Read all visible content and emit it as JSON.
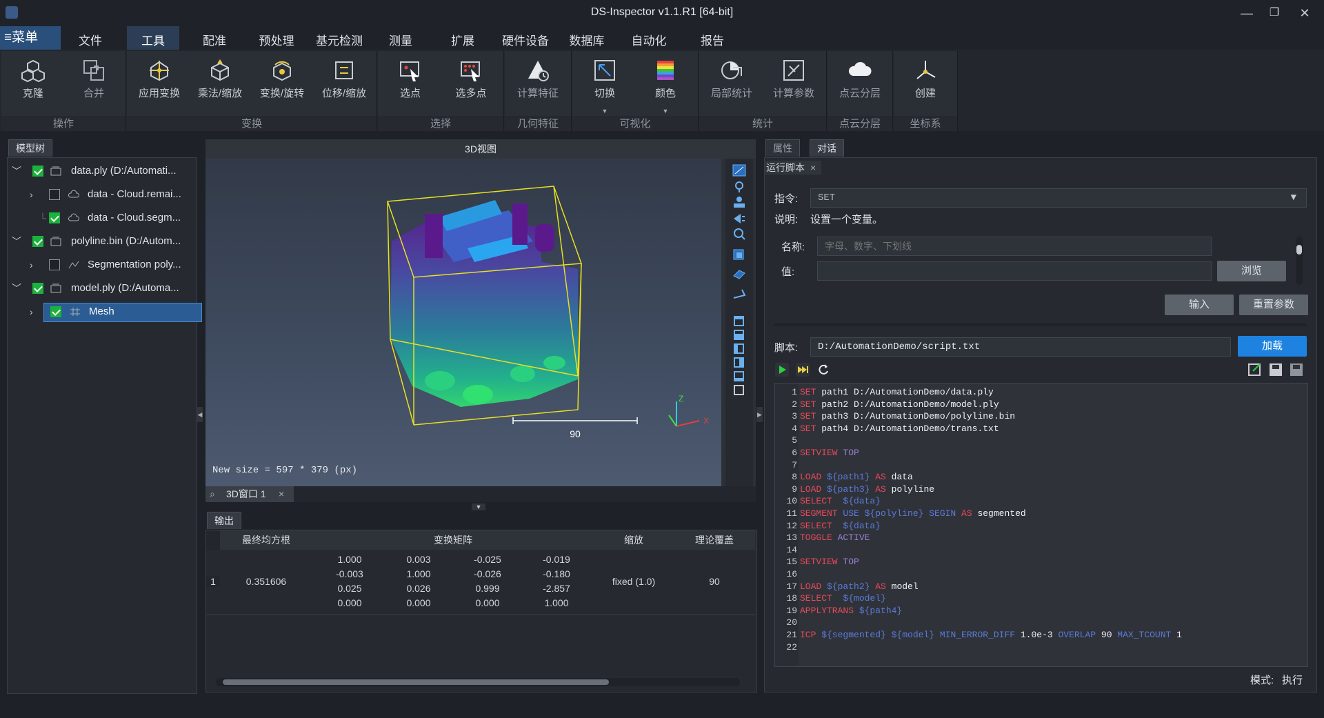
{
  "window": {
    "title": "DS-Inspector v1.1.R1 [64-bit]",
    "min": "—",
    "restore": "❐",
    "close": "✕"
  },
  "menu": {
    "main_label": "≡菜单",
    "tabs": [
      "文件",
      "工具",
      "配准",
      "预处理",
      "基元检测",
      "测量",
      "扩展",
      "硬件设备",
      "数据库",
      "自动化",
      "报告"
    ],
    "active_tab": "工具"
  },
  "ribbon": {
    "groups": [
      {
        "label": "操作",
        "buttons": [
          "克隆",
          "合并"
        ]
      },
      {
        "label": "变换",
        "buttons": [
          "应用变换",
          "乘法/缩放",
          "变换/旋转",
          "位移/缩放"
        ]
      },
      {
        "label": "选择",
        "buttons": [
          "选点",
          "选多点"
        ]
      },
      {
        "label": "几何特征",
        "buttons": [
          "计算特征"
        ]
      },
      {
        "label": "可视化",
        "buttons": [
          "切换",
          "颜色"
        ]
      },
      {
        "label": "统计",
        "buttons": [
          "局部统计",
          "计算参数"
        ]
      },
      {
        "label": "点云分层",
        "buttons": [
          "点云分层"
        ]
      },
      {
        "label": "坐标系",
        "buttons": [
          "创建"
        ]
      }
    ]
  },
  "model_tree": {
    "tab": "模型树",
    "items": [
      {
        "label": "data.ply (D:/Automati...",
        "checked": true,
        "expanded": true,
        "level": 0
      },
      {
        "label": "data - Cloud.remai...",
        "checked": false,
        "expanded": false,
        "level": 1
      },
      {
        "label": "data - Cloud.segm...",
        "checked": true,
        "expanded": null,
        "level": 1
      },
      {
        "label": "polyline.bin (D:/Autom...",
        "checked": true,
        "expanded": true,
        "level": 0
      },
      {
        "label": "Segmentation poly...",
        "checked": false,
        "expanded": false,
        "level": 1
      },
      {
        "label": "model.ply (D:/Automa...",
        "checked": true,
        "expanded": true,
        "level": 0
      },
      {
        "label": "Mesh",
        "checked": true,
        "expanded": false,
        "level": 1,
        "selected": true
      }
    ]
  },
  "view3d": {
    "title": "3D视图",
    "status": "New size = 597 * 379 (px)",
    "scale_label": "90",
    "axis_z": "Z",
    "axis_x": "X",
    "tab_label": "3D窗口 1",
    "tab_close": "×"
  },
  "output": {
    "tab": "输出",
    "columns": [
      "最终均方根",
      "变换矩阵",
      "缩放",
      "理论覆盖"
    ],
    "rows": [
      {
        "index": "1",
        "rms": "0.351606",
        "matrix": [
          [
            "1.000",
            "0.003",
            "-0.025",
            "-0.019"
          ],
          [
            "-0.003",
            "1.000",
            "-0.026",
            "-0.180"
          ],
          [
            "0.025",
            "0.026",
            "0.999",
            "-2.857"
          ],
          [
            "0.000",
            "0.000",
            "0.000",
            "1.000"
          ]
        ],
        "scale": "fixed (1.0)",
        "overlap": "90"
      }
    ]
  },
  "right_panel": {
    "tabs": [
      "属性",
      "对话"
    ],
    "active_tab": "对话",
    "sub_tab": "运行脚本",
    "sub_tab_close": "×",
    "command_label": "指令:",
    "command_value": "SET",
    "desc_label": "说明:",
    "desc_value": "设置一个变量。",
    "name_label": "名称:",
    "name_placeholder": "字母、数字、下划线",
    "value_label": "值:",
    "value_value": "",
    "browse_button": "浏览",
    "input_button": "输入",
    "reset_button": "重置参数",
    "script_label": "脚本:",
    "script_path": "D:/AutomationDemo/script.txt",
    "load_button": "加载",
    "mode_label": "模式:",
    "mode_value": "执行"
  },
  "script_lines": [
    [
      "1",
      [
        [
          "kw",
          "SET"
        ],
        [
          "tx",
          " path1 D:/AutomationDemo/data.ply"
        ]
      ]
    ],
    [
      "2",
      [
        [
          "kw",
          "SET"
        ],
        [
          "tx",
          " path2 D:/AutomationDemo/model.ply"
        ]
      ]
    ],
    [
      "3",
      [
        [
          "kw",
          "SET"
        ],
        [
          "tx",
          " path3 D:/AutomationDemo/polyline.bin"
        ]
      ]
    ],
    [
      "4",
      [
        [
          "kw",
          "SET"
        ],
        [
          "tx",
          " path4 D:/AutomationDemo/trans.txt"
        ]
      ]
    ],
    [
      "5",
      []
    ],
    [
      "6",
      [
        [
          "kw",
          "SETVIEW"
        ],
        [
          "dk",
          " TOP"
        ]
      ]
    ],
    [
      "7",
      []
    ],
    [
      "8",
      [
        [
          "kw",
          "LOAD"
        ],
        [
          "vr",
          " ${path1} "
        ],
        [
          "kw",
          "AS"
        ],
        [
          "tx",
          " data"
        ]
      ]
    ],
    [
      "9",
      [
        [
          "kw",
          "LOAD"
        ],
        [
          "vr",
          " ${path3} "
        ],
        [
          "kw",
          "AS"
        ],
        [
          "tx",
          " polyline"
        ]
      ]
    ],
    [
      "10",
      [
        [
          "kw",
          "SELECT"
        ],
        [
          "vr",
          "  ${data}"
        ]
      ]
    ],
    [
      "11",
      [
        [
          "kw",
          "SEGMENT"
        ],
        [
          "vr",
          " USE ${polyline} SEGIN "
        ],
        [
          "kw",
          "AS"
        ],
        [
          "tx",
          " segmented"
        ]
      ]
    ],
    [
      "12",
      [
        [
          "kw",
          "SELECT"
        ],
        [
          "vr",
          "  ${data}"
        ]
      ]
    ],
    [
      "13",
      [
        [
          "kw",
          "TOGGLE"
        ],
        [
          "dk",
          " ACTIVE"
        ]
      ]
    ],
    [
      "14",
      []
    ],
    [
      "15",
      [
        [
          "kw",
          "SETVIEW"
        ],
        [
          "dk",
          " TOP"
        ]
      ]
    ],
    [
      "16",
      []
    ],
    [
      "17",
      [
        [
          "kw",
          "LOAD"
        ],
        [
          "vr",
          " ${path2} "
        ],
        [
          "kw",
          "AS"
        ],
        [
          "tx",
          " model"
        ]
      ]
    ],
    [
      "18",
      [
        [
          "kw",
          "SELECT"
        ],
        [
          "vr",
          "  ${model}"
        ]
      ]
    ],
    [
      "19",
      [
        [
          "kw",
          "APPLYTRANS"
        ],
        [
          "vr",
          " ${path4}"
        ]
      ]
    ],
    [
      "20",
      []
    ],
    [
      "21",
      [
        [
          "kw",
          "ICP"
        ],
        [
          "vr",
          " ${segmented} ${model} MIN_ERROR_DIFF "
        ],
        [
          "tx",
          "1.0e-3 "
        ],
        [
          "vr",
          "OVERLAP "
        ],
        [
          "tx",
          "90 "
        ],
        [
          "vr",
          "MAX_TCOUNT "
        ],
        [
          "tx",
          "1"
        ]
      ]
    ],
    [
      "22",
      []
    ]
  ]
}
